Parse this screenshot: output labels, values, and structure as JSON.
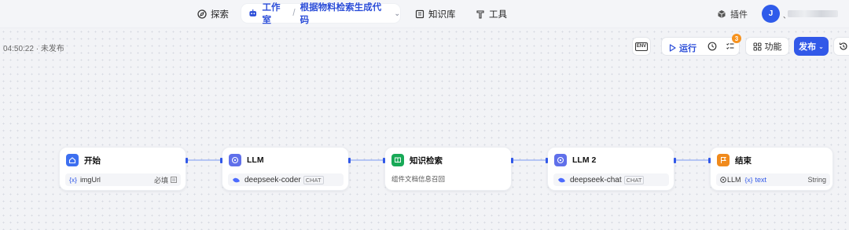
{
  "nav": {
    "explore": "探索",
    "studio": "工作室",
    "separator": "/",
    "workflow_name": "根据物料检索生成代码",
    "knowledge": "知识库",
    "tools": "工具",
    "plugins": "插件",
    "avatar_initial": "J",
    "user_prefix": "、"
  },
  "status": {
    "text": "04:50:22 · 未发布"
  },
  "toolbar": {
    "env_label": "ENV",
    "run_label": "运行",
    "badge_count": "3",
    "features_label": "功能",
    "publish_label": "发布"
  },
  "nodes": [
    {
      "title": "开始",
      "icon": "home-icon",
      "color": "#3d6ff0",
      "var_tag": "{x}",
      "var_name": "imgUrl",
      "right_text": "必填"
    },
    {
      "title": "LLM",
      "icon": "llm-icon",
      "color": "#6070ea",
      "model": "deepseek-coder",
      "tag": "CHAT"
    },
    {
      "title": "知识检索",
      "icon": "book-icon",
      "color": "#18a957",
      "description": "组件文档信息召回"
    },
    {
      "title": "LLM 2",
      "icon": "llm-icon",
      "color": "#6070ea",
      "model": "deepseek-chat",
      "tag": "CHAT"
    },
    {
      "title": "结束",
      "icon": "flag-icon",
      "color": "#f08a1c",
      "source": "LLM",
      "var_tag": "{x}",
      "var_name": "text",
      "type": "String"
    }
  ],
  "colors": {
    "accent": "#3158e8",
    "badge": "#f6921e"
  }
}
